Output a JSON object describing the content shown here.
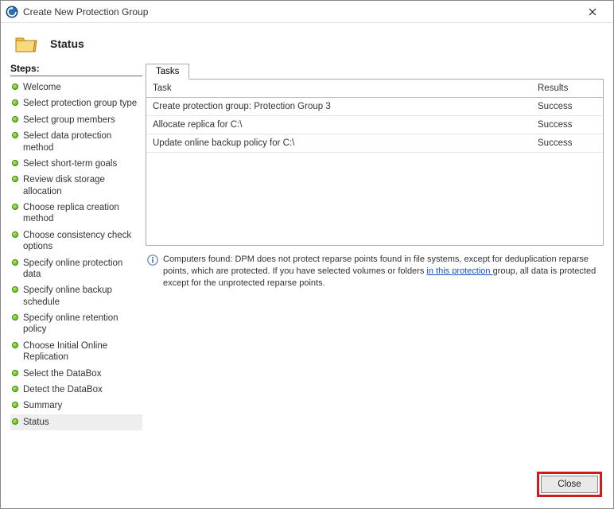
{
  "titlebar": {
    "title": "Create New Protection Group"
  },
  "header": {
    "page_title": "Status"
  },
  "sidebar": {
    "title": "Steps:",
    "items": [
      {
        "label": "Welcome"
      },
      {
        "label": "Select protection group type"
      },
      {
        "label": "Select group members"
      },
      {
        "label": "Select data protection method"
      },
      {
        "label": "Select short-term goals"
      },
      {
        "label": "Review disk storage allocation"
      },
      {
        "label": "Choose replica creation method"
      },
      {
        "label": "Choose consistency check options"
      },
      {
        "label": "Specify online protection data"
      },
      {
        "label": "Specify online backup schedule"
      },
      {
        "label": "Specify online retention policy"
      },
      {
        "label": "Choose Initial Online Replication"
      },
      {
        "label": "Select the DataBox"
      },
      {
        "label": "Detect the DataBox"
      },
      {
        "label": "Summary"
      },
      {
        "label": "Status"
      }
    ],
    "active_index": 15
  },
  "content": {
    "tabs": [
      {
        "label": "Tasks"
      }
    ],
    "active_tab_index": 0,
    "table": {
      "columns": [
        "Task",
        "Results"
      ],
      "rows": [
        {
          "task": "Create protection group: Protection Group 3",
          "result": "Success"
        },
        {
          "task": "Allocate replica for C:\\",
          "result": "Success"
        },
        {
          "task": "Update online backup policy for C:\\",
          "result": "Success"
        }
      ]
    },
    "info": {
      "text_before": "Computers found: DPM does not protect reparse points found in file systems, except for deduplication reparse points, which are protected. If you have selected volumes or folders ",
      "link_text": "in this protection ",
      "text_after": "group, all data is protected except for the unprotected reparse points."
    }
  },
  "footer": {
    "close_label": "Close"
  }
}
